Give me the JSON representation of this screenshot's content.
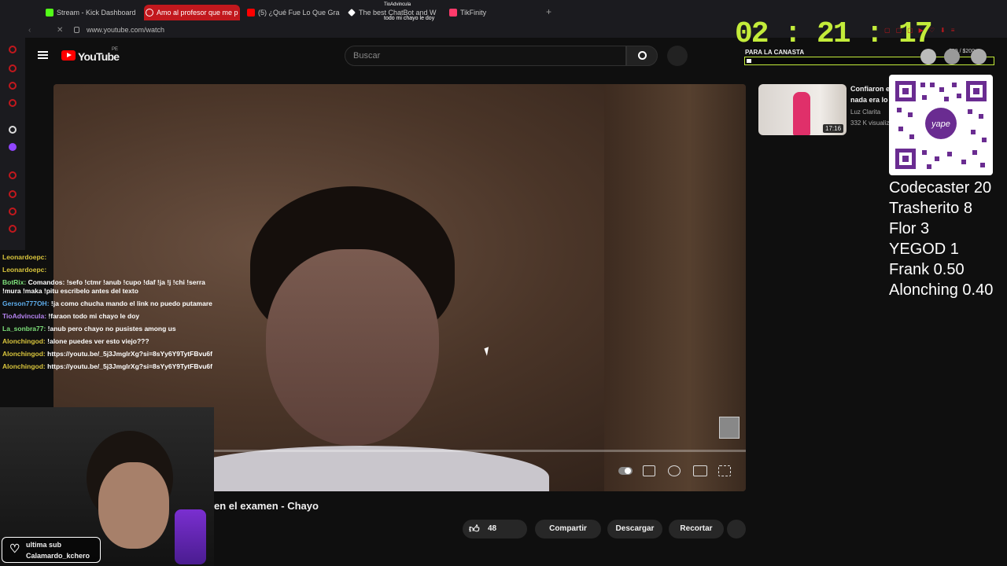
{
  "browser": {
    "tabs": [
      {
        "label": "Stream - Kick Dashboard",
        "color": "#53fc18"
      },
      {
        "label": "Amo al profesor que me p",
        "color": "#ff4d4d"
      },
      {
        "label": "(5) ¿Qué Fue Lo Que Gra",
        "color": "#ff0000"
      },
      {
        "label": "The best ChatBot and W",
        "color": "#ffffff"
      },
      {
        "label": "TikFinity",
        "color": "#ff3b6b"
      }
    ],
    "tab_tooltip_user": "TioAdvincula",
    "tab_tooltip_text": "todo mi chayo le doy",
    "url": "www.youtube.com/watch"
  },
  "youtube": {
    "logo": "YouTube",
    "country": "PE",
    "search_placeholder": "Buscar",
    "video_title": "en el examen - Chayo",
    "likes": "48",
    "share_label": "Compartir",
    "download_label": "Descargar",
    "clip_label": "Recortar",
    "recommended": {
      "title_line1": "Confiaron e",
      "title_line2": "nada era lo",
      "channel": "Luz Clarita",
      "views": "332 K visualiz",
      "duration": "17:16"
    }
  },
  "overlay": {
    "timer": "02 : 21 : 17",
    "goal_label": "PARA LA CANASTA",
    "goal_numbers": "$39 / $200",
    "goal_fraction": 0.02,
    "donors": [
      "Codecaster 20",
      "Trasherito 8",
      "Flor 3",
      "YEGOD 1",
      "Frank 0.50",
      "Alonching 0.40"
    ],
    "last_sub_label": "ultima sub",
    "last_sub_user": "Calamardo_kchero",
    "chat": [
      {
        "user": "Leonardoepc:",
        "text": "",
        "cls": ""
      },
      {
        "user": "Leonardoepc:",
        "text": "",
        "cls": ""
      },
      {
        "user": "BotRix:",
        "text": "Comandos: !sefo !ctmr !anub !cupo !daf !ja !j !chi !serra !mura !maka !pitu escribelo antes del texto",
        "cls": "green"
      },
      {
        "user": "Gerson777OH:",
        "text": "!ja como chucha mando el link no puedo putamare",
        "cls": "blue"
      },
      {
        "user": "TioAdvincula:",
        "text": "!faraon todo mi chayo le doy",
        "cls": "purple"
      },
      {
        "user": "La_sonbra77:",
        "text": "!anub pero chayo no pusistes among us",
        "cls": "green"
      },
      {
        "user": "Alonchingod:",
        "text": "!alone puedes ver esto viejo???",
        "cls": ""
      },
      {
        "user": "Alonchingod:",
        "text": "https://youtu.be/_5j3JmglrXg?si=8sYy6Y9TytFBvu6f",
        "cls": ""
      },
      {
        "user": "Alonchingod:",
        "text": "https://youtu.be/_5j3JmglrXg?si=8sYy6Y9TytFBvu6f",
        "cls": ""
      }
    ]
  }
}
